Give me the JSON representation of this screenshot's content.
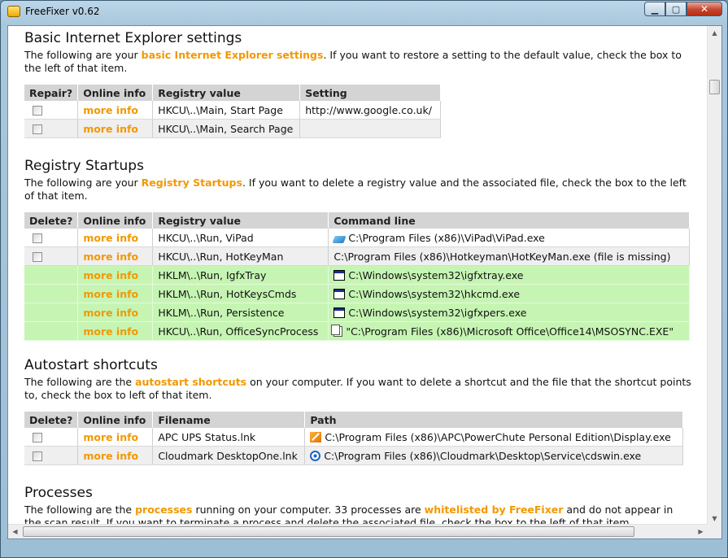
{
  "window": {
    "title": "FreeFixer v0.62",
    "min_glyph": "▁",
    "max_glyph": "▢",
    "close_glyph": "✕"
  },
  "sections": {
    "ie": {
      "heading": "Basic Internet Explorer settings",
      "para_pre": "The following are your ",
      "para_link": "basic Internet Explorer settings",
      "para_post": ". If you want to restore a setting to the default value, check the box to the left of that item.",
      "columns": [
        "Repair?",
        "Online info",
        "Registry value",
        "Setting"
      ],
      "rows": [
        {
          "info": "more info",
          "registry": "HKCU\\..\\Main, Start Page",
          "setting": "http://www.google.co.uk/"
        },
        {
          "info": "more info",
          "registry": "HKCU\\..\\Main, Search Page",
          "setting": ""
        }
      ]
    },
    "startups": {
      "heading": "Registry Startups",
      "para_pre": "The following are your ",
      "para_link": "Registry Startups",
      "para_post": ". If you want to delete a registry value and the associated file, check the box to the left of that item.",
      "columns": [
        "Delete?",
        "Online info",
        "Registry value",
        "Command line"
      ],
      "rows": [
        {
          "info": "more info",
          "registry": "HKCU\\..\\Run, ViPad",
          "command": "C:\\Program Files (x86)\\ViPad\\ViPad.exe",
          "icon": "vipad-icon"
        },
        {
          "info": "more info",
          "registry": "HKCU\\..\\Run, HotKeyMan",
          "command": "C:\\Program Files (x86)\\Hotkeyman\\HotKeyMan.exe (file is missing)",
          "icon": ""
        },
        {
          "info": "more info",
          "registry": "HKLM\\..\\Run, IgfxTray",
          "command": "C:\\Windows\\system32\\igfxtray.exe",
          "icon": "window-icon"
        },
        {
          "info": "more info",
          "registry": "HKLM\\..\\Run, HotKeysCmds",
          "command": "C:\\Windows\\system32\\hkcmd.exe",
          "icon": "window-icon"
        },
        {
          "info": "more info",
          "registry": "HKLM\\..\\Run, Persistence",
          "command": "C:\\Windows\\system32\\igfxpers.exe",
          "icon": "window-icon"
        },
        {
          "info": "more info",
          "registry": "HKCU\\..\\Run, OfficeSyncProcess",
          "command": "\"C:\\Program Files (x86)\\Microsoft Office\\Office14\\MSOSYNC.EXE\"",
          "icon": "document-icon"
        }
      ]
    },
    "shortcuts": {
      "heading": "Autostart shortcuts",
      "para_pre": "The following are the ",
      "para_link": "autostart shortcuts",
      "para_post": " on your computer. If you want to delete a shortcut and the file that the shortcut points to, check the box to left of that item.",
      "columns": [
        "Delete?",
        "Online info",
        "Filename",
        "Path"
      ],
      "rows": [
        {
          "info": "more info",
          "filename": "APC UPS Status.lnk",
          "path": "C:\\Program Files (x86)\\APC\\PowerChute Personal Edition\\Display.exe",
          "icon": "apc-icon"
        },
        {
          "info": "more info",
          "filename": "Cloudmark DesktopOne.lnk",
          "path": "C:\\Program Files (x86)\\Cloudmark\\Desktop\\Service\\cdswin.exe",
          "icon": "cloudmark-icon"
        }
      ]
    },
    "processes": {
      "heading": "Processes",
      "para_pre": "The following are the ",
      "para_link": "processes",
      "para_mid": " running on your computer. 33 processes are ",
      "para_link2": "whitelisted by FreeFixer",
      "para_post": " and do not appear in the scan result. If you want to terminate a process and delete the associated file, check the box to the left of that item."
    }
  },
  "scrollbars": {
    "up": "▲",
    "down": "▼",
    "left": "◀",
    "right": "▶",
    "grip": "≡",
    "hgrip": "|||"
  }
}
